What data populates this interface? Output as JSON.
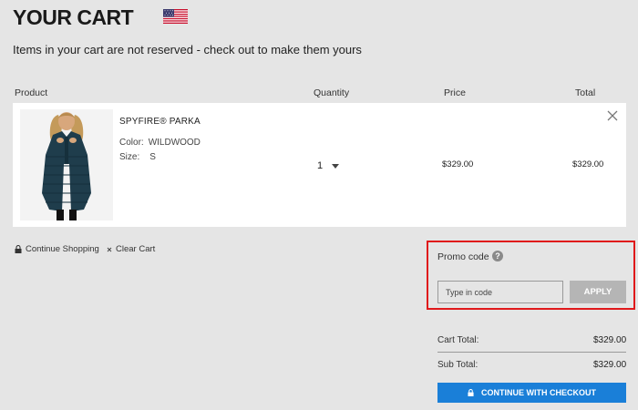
{
  "header": {
    "title": "YOUR CART",
    "flag_icon": "us-flag-icon",
    "notice": "Items in your cart are not reserved - check out to make them yours"
  },
  "table": {
    "columns": [
      "Product",
      "Quantity",
      "Price",
      "Total"
    ]
  },
  "item": {
    "name": "SPYFIRE® PARKA",
    "color_label": "Color:",
    "color_value": "WILDWOOD",
    "size_label": "Size:",
    "size_value": "S",
    "quantity": "1",
    "price": "$329.00",
    "total": "$329.00"
  },
  "links": {
    "continue_shopping": "Continue Shopping",
    "clear_cart": "Clear Cart"
  },
  "promo": {
    "label": "Promo code",
    "help": "?",
    "placeholder": "Type in code",
    "apply_label": "APPLY"
  },
  "summary": {
    "cart_total_label": "Cart Total:",
    "cart_total_value": "$329.00",
    "sub_total_label": "Sub Total:",
    "sub_total_value": "$329.00"
  },
  "checkout": {
    "label": "CONTINUE WITH CHECKOUT"
  },
  "colors": {
    "accent": "#1a7fd8",
    "highlight": "#e0191b",
    "background": "#e5e5e5"
  }
}
